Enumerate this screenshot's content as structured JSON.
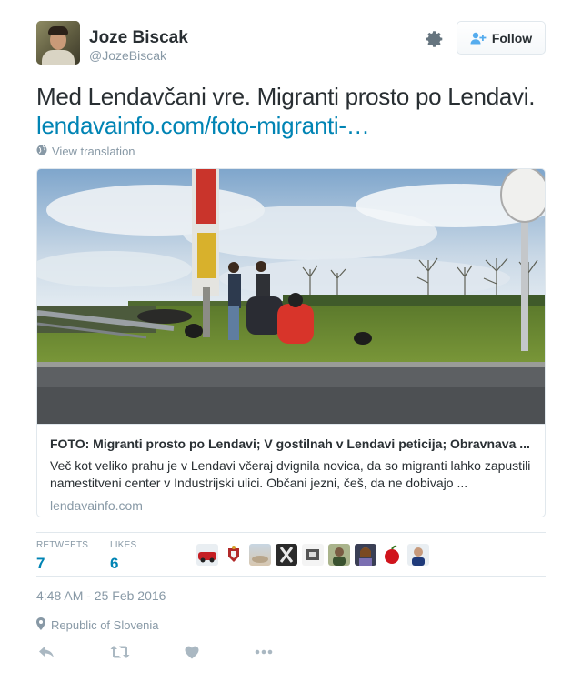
{
  "author": {
    "name": "Joze Biscak",
    "handle": "@JozeBiscak"
  },
  "follow_label": "Follow",
  "tweet": {
    "text": "Med Lendavčani vre. Migranti prosto po Lendavi.",
    "link": "lendavainfo.com/foto-migranti-…"
  },
  "translate_label": "View translation",
  "card": {
    "title": "FOTO: Migranti prosto po Lendavi; V gostilnah v Lendavi peticija; Obravnava ...",
    "description": "Več kot veliko prahu je v Lendavi včeraj dvignila novica, da so migranti lahko zapustili namestitveni center v Industrijski ulici. Občani jezni, češ, da ne dobivajo ...",
    "domain": "lendavainfo.com"
  },
  "stats": {
    "retweets_label": "RETWEETS",
    "retweets": "7",
    "likes_label": "LIKES",
    "likes": "6"
  },
  "timestamp": "4:48 AM - 25 Feb 2016",
  "location": "Republic of Slovenia",
  "colors": {
    "link": "#0084b4",
    "muted": "#8899a6",
    "text": "#292f33",
    "border": "#e1e8ed"
  },
  "icons": [
    "gear-icon",
    "follow-person-icon",
    "globe-icon",
    "location-pin-icon",
    "reply-icon",
    "retweet-icon",
    "like-icon",
    "more-icon"
  ]
}
